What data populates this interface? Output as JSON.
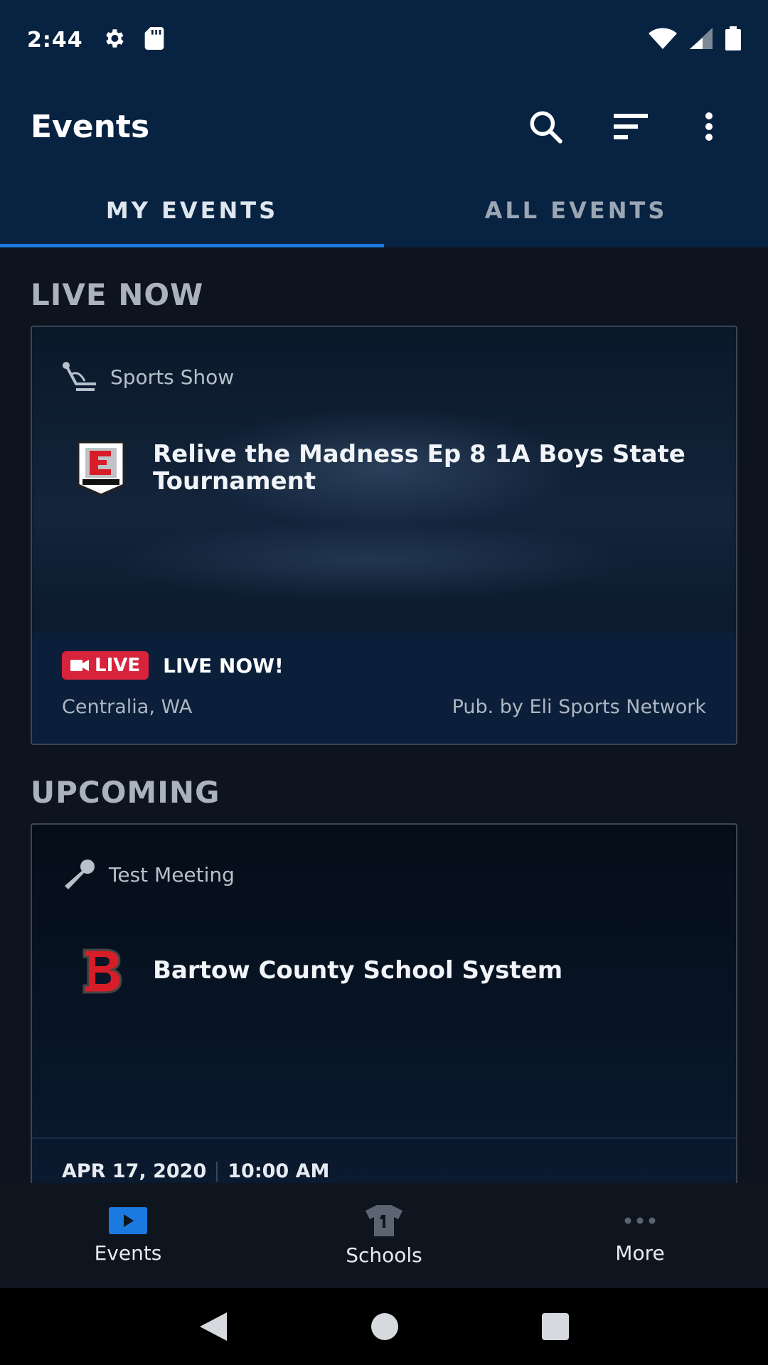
{
  "status_bar": {
    "time": "2:44"
  },
  "app_bar": {
    "title": "Events"
  },
  "tabs": [
    {
      "label": "MY EVENTS",
      "active": true
    },
    {
      "label": "ALL EVENTS",
      "active": false
    }
  ],
  "sections": {
    "live_now": "LIVE NOW",
    "upcoming": "UPCOMING"
  },
  "live_card": {
    "category": "Sports Show",
    "title": "Relive the Madness Ep 8 1A Boys State Tournament",
    "badge": "LIVE",
    "status": "LIVE NOW!",
    "location": "Centralia, WA",
    "publisher": "Pub. by Eli Sports Network"
  },
  "upcoming_card": {
    "category": "Test Meeting",
    "title": "Bartow County School System",
    "date": "APR 17, 2020",
    "time": "10:00 AM"
  },
  "bottom_nav": [
    {
      "label": "Events",
      "icon": "play-icon",
      "active": true
    },
    {
      "label": "Schools",
      "icon": "jersey-icon",
      "active": false
    },
    {
      "label": "More",
      "icon": "more-horizontal-icon",
      "active": false
    }
  ],
  "colors": {
    "header_bg": "#082341",
    "accent": "#1a7ae0",
    "live_red": "#d8233c",
    "content_bg": "#0d141f"
  }
}
